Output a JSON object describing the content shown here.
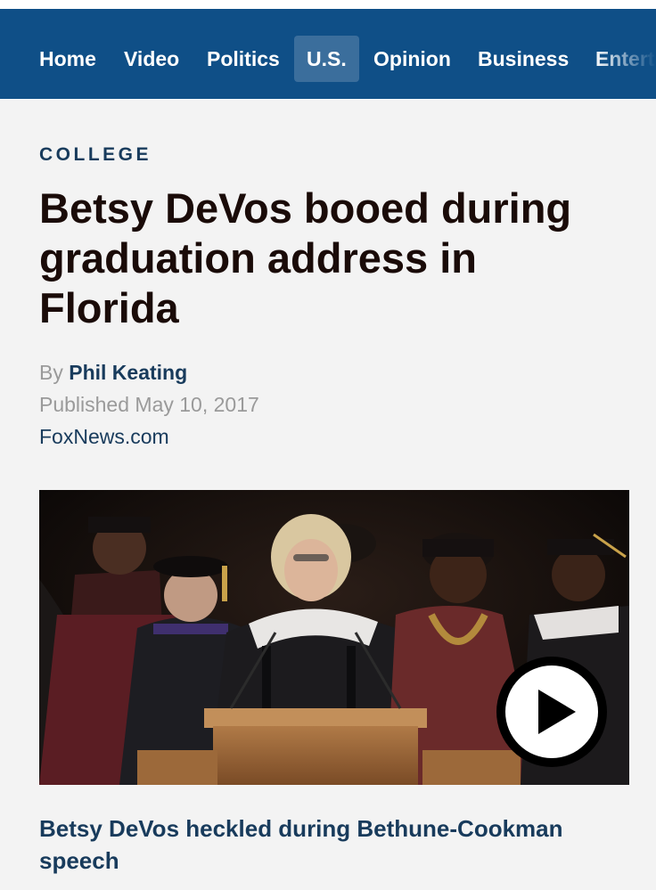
{
  "nav": {
    "items": [
      "Home",
      "Video",
      "Politics",
      "U.S.",
      "Opinion",
      "Business",
      "Entertainment"
    ],
    "active": "U.S."
  },
  "article": {
    "section": "COLLEGE",
    "headline": "Betsy DeVos booed during graduation address in Florida",
    "by_prefix": "By",
    "author": "Phil Keating",
    "published": "Published May 10, 2017",
    "source": "FoxNews.com"
  },
  "video": {
    "caption": "Betsy DeVos heckled during Bethune-Cookman speech"
  },
  "colors": {
    "nav_bg": "#0f4f87",
    "nav_active_bg": "#3b6e9c",
    "link": "#183b5c",
    "headline": "#1a0b08",
    "meta": "#9a9a9a",
    "page_bg": "#f3f3f3"
  }
}
